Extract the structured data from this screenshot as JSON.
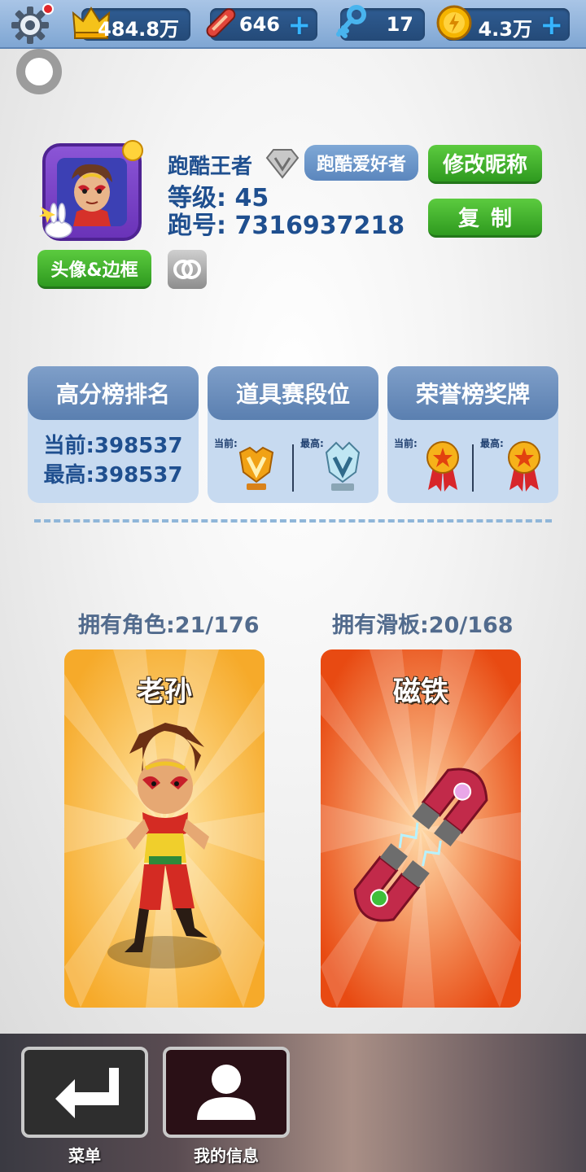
{
  "topbar": {
    "notification": true,
    "resources": [
      {
        "name": "crown",
        "icon": "crown-icon",
        "value": "484.8万",
        "has_plus": false
      },
      {
        "name": "skateboard",
        "icon": "skateboard-icon",
        "value": "646",
        "has_plus": true
      },
      {
        "name": "key",
        "icon": "key-icon",
        "value": "17",
        "has_plus": false
      },
      {
        "name": "coin",
        "icon": "coin-icon",
        "value": "4.3万",
        "has_plus": true
      }
    ],
    "plus_symbol": "+"
  },
  "profile": {
    "nickname": "跑酷王者",
    "title_badge": "跑酷爱好者",
    "level_text": "等级: 45",
    "id_text": "跑号: 7316937218",
    "rename_label": "修改昵称",
    "copy_label": "复制",
    "avatar_frame_label": "头像&边框"
  },
  "stats": [
    {
      "title": "高分榜排名",
      "current_text": "当前:398537",
      "best_text": "最高:398537"
    },
    {
      "title": "道具赛段位",
      "current_label": "当前:",
      "best_label": "最高:"
    },
    {
      "title": "荣誉榜奖牌",
      "current_label": "当前:",
      "best_label": "最高:"
    }
  ],
  "owned": {
    "characters_label": "拥有角色:21/176",
    "boards_label": "拥有滑板:20/168",
    "character_name": "老孙",
    "board_name": "磁铁"
  },
  "nav": {
    "menu_label": "菜单",
    "my_info_label": "我的信息"
  },
  "colors": {
    "accent_blue": "#1f4f8f",
    "green_button": "#3fae2a",
    "character_card": "#f8b63c",
    "board_card": "#ee5a1a"
  }
}
